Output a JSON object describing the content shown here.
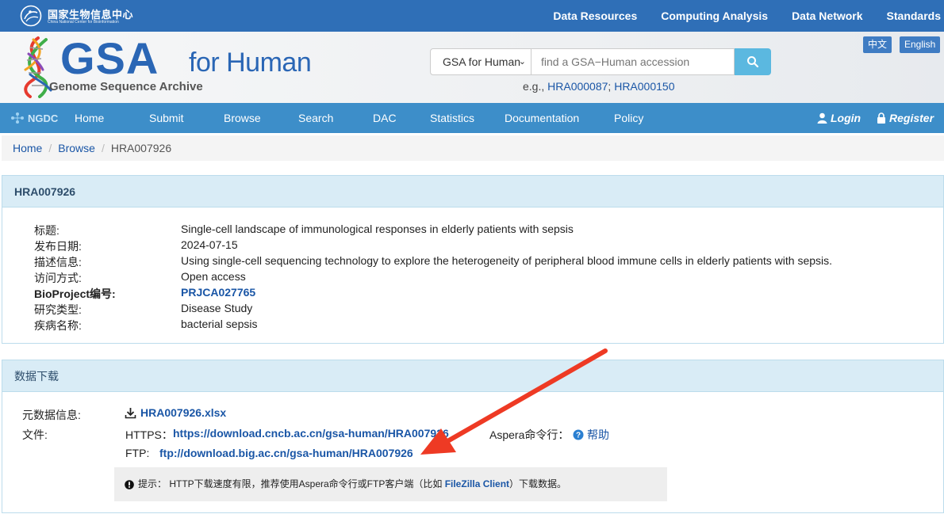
{
  "topbar": {
    "org_cn": "国家生物信息中心",
    "org_en": "China National Center for Bioinformation",
    "links": [
      "Data Resources",
      "Computing Analysis",
      "Data Network",
      "Standards"
    ]
  },
  "header": {
    "logo_main": "GSA",
    "logo_suffix": "for Human",
    "logo_sub": "Genome Sequence Archive",
    "search_select": "GSA for Human",
    "search_placeholder": "find a GSA−Human accession",
    "hint_prefix": "e.g., ",
    "hint_examples": [
      "HRA000087",
      "HRA000150"
    ],
    "hint_sep": "; ",
    "lang_zh": "中文",
    "lang_en": "English"
  },
  "nav": {
    "brand": "NGDC",
    "items": [
      "Home",
      "Submit",
      "Browse",
      "Search",
      "DAC",
      "Statistics",
      "Documentation",
      "Policy"
    ],
    "login": "Login",
    "register": "Register"
  },
  "breadcrumb": {
    "items": [
      "Home",
      "Browse"
    ],
    "current": "HRA007926"
  },
  "overview": {
    "heading": "HRA007926",
    "rows": [
      {
        "label": "标题:",
        "value": "Single-cell landscape of immunological responses in elderly patients with sepsis"
      },
      {
        "label": "发布日期:",
        "value": "2024-07-15"
      },
      {
        "label": "描述信息:",
        "value": "Using single-cell sequencing technology to explore the heterogeneity of peripheral blood immune cells in elderly patients with sepsis."
      },
      {
        "label": "访问方式:",
        "value": "Open access"
      },
      {
        "label": "BioProject编号:",
        "value": "PRJCA027765"
      },
      {
        "label": "研究类型:",
        "value": "Disease Study"
      },
      {
        "label": "疾病名称:",
        "value": "bacterial sepsis"
      }
    ]
  },
  "download": {
    "heading": "数据下载",
    "meta_label": "元数据信息:",
    "meta_file": "HRA007926.xlsx",
    "files_label": "文件:",
    "https_label": "HTTPS：",
    "https_url": "https://download.cncb.ac.cn/gsa-human/HRA007926",
    "ftp_label": "FTP: ",
    "ftp_url": "ftp://download.big.ac.cn/gsa-human/HRA007926",
    "aspera_label": "Aspera命令行：",
    "help": "帮助",
    "notice_prefix": "提示： HTTP下载速度有限，推荐使用Aspera命令行或FTP客户端（比如 ",
    "notice_link": "FileZilla Client",
    "notice_suffix": "）下载数据。"
  },
  "colors": {
    "topbar": "#2f6fb7",
    "nav": "#3d8ec9",
    "link": "#1a56a6",
    "annotation_arrow": "#ee3a24"
  }
}
